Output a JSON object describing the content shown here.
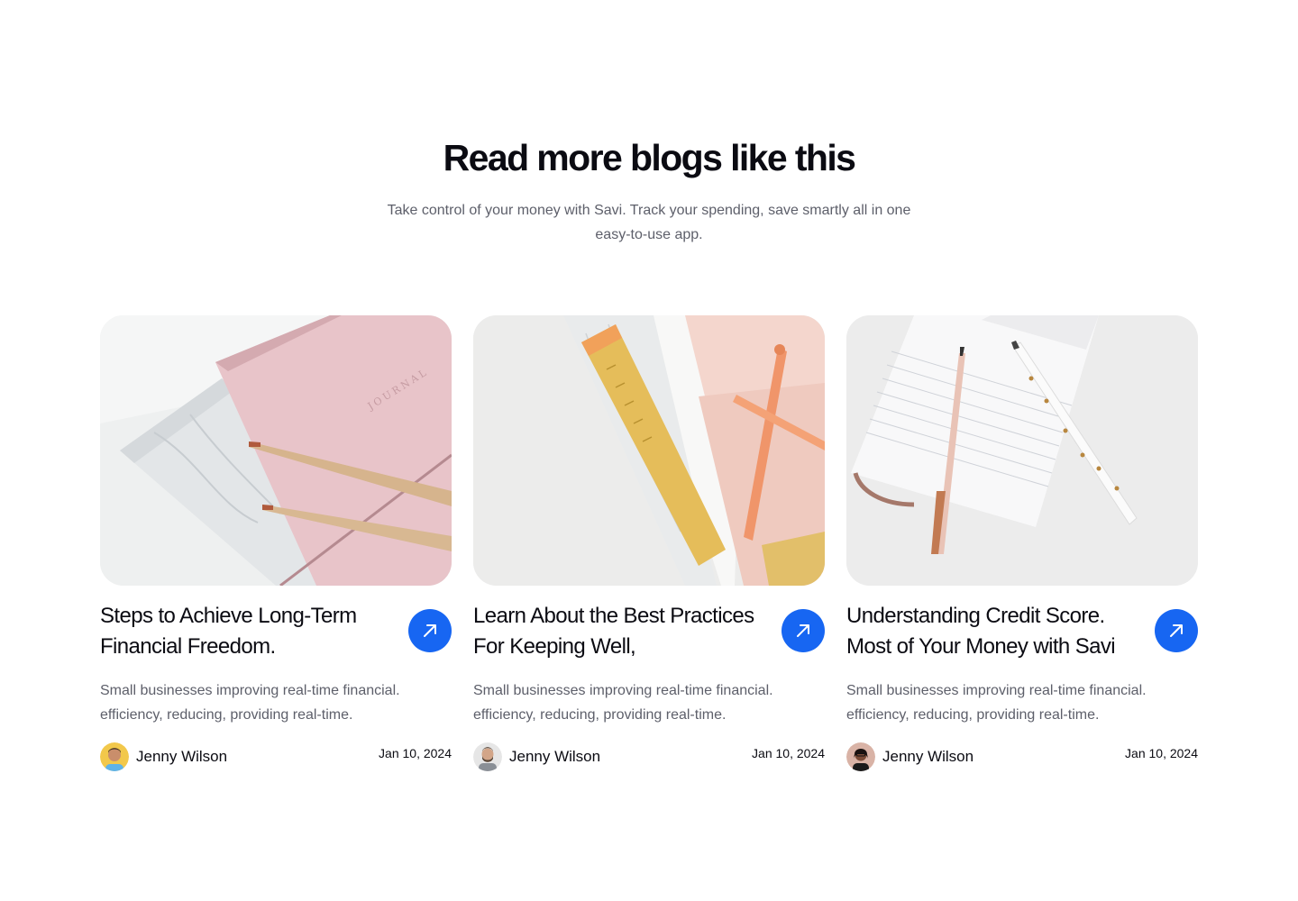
{
  "section": {
    "title": "Read more blogs like this",
    "subtitle": "Take control of your money with Savi. Track your spending, save smartly all in one easy-to-use app."
  },
  "posts": [
    {
      "title": "Steps to Achieve Long-Term Financial Freedom.",
      "description": "Small businesses improving real-time financial. efficiency, reducing, providing real-time.",
      "author": "Jenny Wilson",
      "date": "Jan 10, 2024",
      "image": "pink-journal-pencils-photo",
      "button_icon": "arrow-up-right-icon"
    },
    {
      "title": "Learn About the Best Practices For Keeping Well,",
      "description": "Small businesses improving real-time financial. efficiency, reducing, providing real-time.",
      "author": "Jenny Wilson",
      "date": "Jan 10, 2024",
      "image": "ruler-pen-notebooks-photo",
      "button_icon": "arrow-up-right-icon"
    },
    {
      "title": "Understanding Credit Score. Most of Your Money with Savi",
      "description": "Small businesses improving real-time financial. efficiency, reducing, providing real-time.",
      "author": "Jenny Wilson",
      "date": "Jan 10, 2024",
      "image": "notepad-pens-photo",
      "button_icon": "arrow-up-right-icon"
    }
  ],
  "colors": {
    "accent": "#1766f2",
    "heading": "#0b0b12",
    "body_text": "#5d5f6a",
    "background": "#ffffff"
  }
}
